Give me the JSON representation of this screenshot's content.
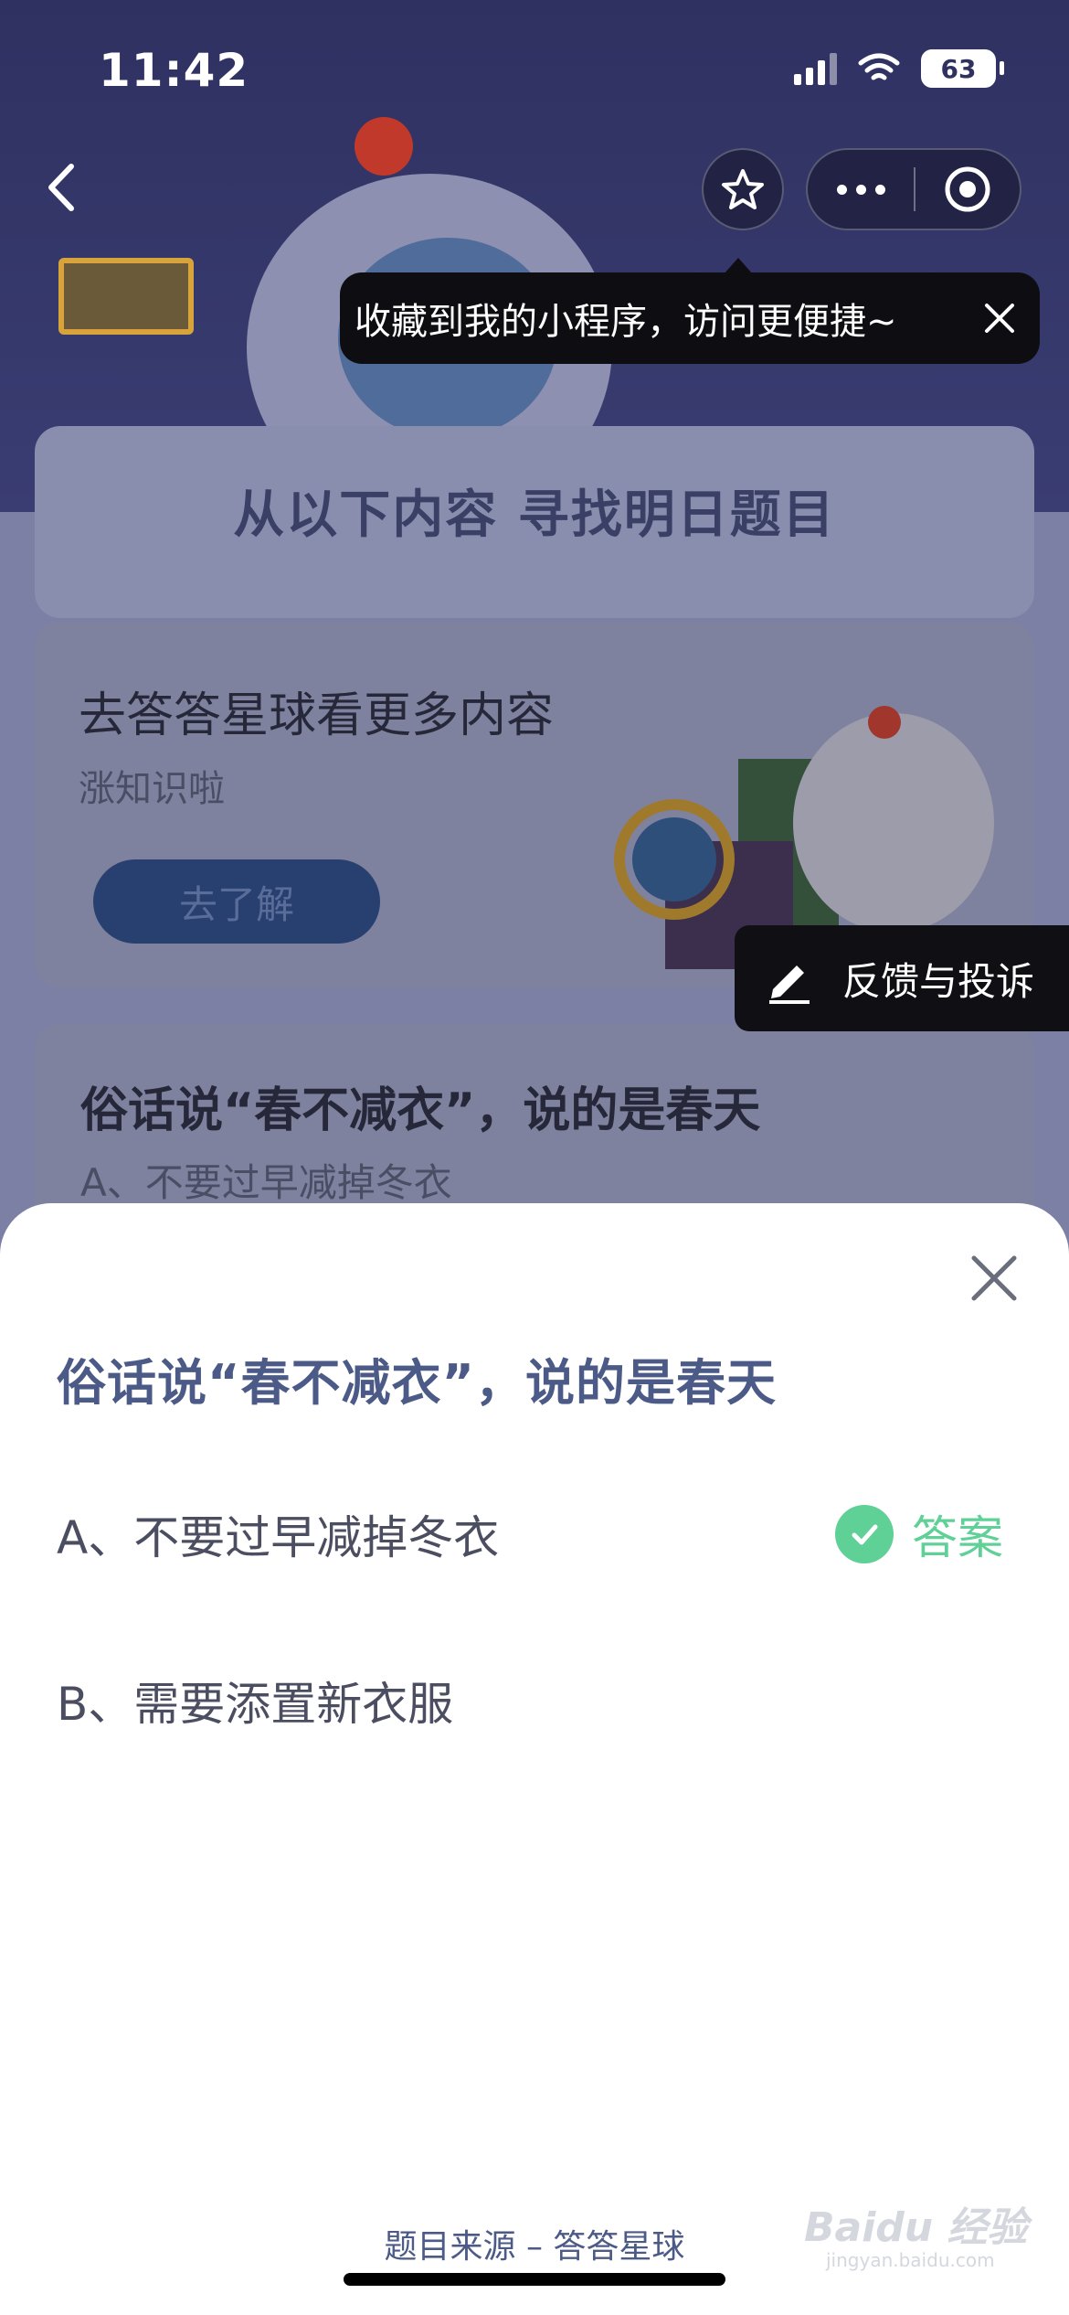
{
  "status_bar": {
    "time": "11:42",
    "battery": "63"
  },
  "nav": {
    "tooltip_text": "收藏到我的小程序，访问更便捷~"
  },
  "background": {
    "section_title": "从以下内容 寻找明日题目",
    "promo": {
      "title": "去答答星球看更多内容",
      "subtitle": "涨知识啦",
      "button_label": "去了解"
    },
    "feedback_label": "反馈与投诉",
    "question_preview": {
      "question": "俗话说“春不减衣”，说的是春天",
      "option_a": "A、不要过早减掉冬衣"
    }
  },
  "sheet": {
    "question": "俗话说“春不减衣”，说的是春天",
    "options": [
      {
        "label": "A、不要过早减掉冬衣",
        "is_answer": true
      },
      {
        "label": "B、需要添置新衣服",
        "is_answer": false
      }
    ],
    "answer_label": "答案",
    "source": "题目来源 – 答答星球"
  },
  "watermark": {
    "brand": "Baidu 经验",
    "url": "jingyan.baidu.com"
  },
  "colors": {
    "answer_green": "#5fd096",
    "question_blue": "#4b5a86"
  }
}
